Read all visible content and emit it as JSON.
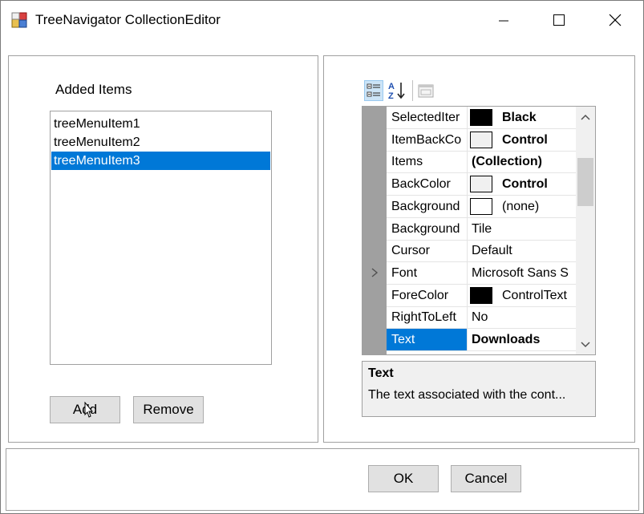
{
  "window": {
    "title": "TreeNavigator CollectionEditor"
  },
  "left": {
    "added_items_label": "Added Items",
    "items": [
      "treeMenuItem1",
      "treeMenuItem2",
      "treeMenuItem3"
    ],
    "selected_index": 2,
    "add_label": "Add",
    "remove_label": "Remove"
  },
  "property_grid": {
    "rows": [
      {
        "name": "SelectedIter",
        "value": "Black",
        "bold": true,
        "swatch": "#000000"
      },
      {
        "name": "ItemBackCo",
        "value": "Control",
        "bold": true,
        "swatch": "#f0f0f0"
      },
      {
        "name": "Items",
        "value": "(Collection)",
        "bold": true,
        "swatch": null
      },
      {
        "name": "BackColor",
        "value": "Control",
        "bold": true,
        "swatch": "#f0f0f0"
      },
      {
        "name": "Background",
        "value": "(none)",
        "bold": false,
        "swatch": "#ffffff"
      },
      {
        "name": "Background",
        "value": "Tile",
        "bold": false,
        "swatch": null
      },
      {
        "name": "Cursor",
        "value": "Default",
        "bold": false,
        "swatch": null
      },
      {
        "name": "Font",
        "value": "Microsoft Sans S",
        "bold": false,
        "swatch": null
      },
      {
        "name": "ForeColor",
        "value": "ControlText",
        "bold": false,
        "swatch": "#000000"
      },
      {
        "name": "RightToLeft",
        "value": "No",
        "bold": false,
        "swatch": null
      },
      {
        "name": "Text",
        "value": "Downloads",
        "bold": true,
        "swatch": null
      }
    ],
    "selected_index": 10,
    "description_title": "Text",
    "description_text": "The text associated with the cont..."
  },
  "footer": {
    "ok_label": "OK",
    "cancel_label": "Cancel"
  },
  "colors": {
    "selection": "#0078d7",
    "button_face": "#e1e1e1",
    "gutter": "#a0a0a0"
  },
  "icons": {
    "app": "collection-editor-app-icon",
    "categorized": "categorized-view-icon",
    "alphabetical": "alphabetical-sort-icon",
    "property_pages": "property-pages-icon"
  }
}
